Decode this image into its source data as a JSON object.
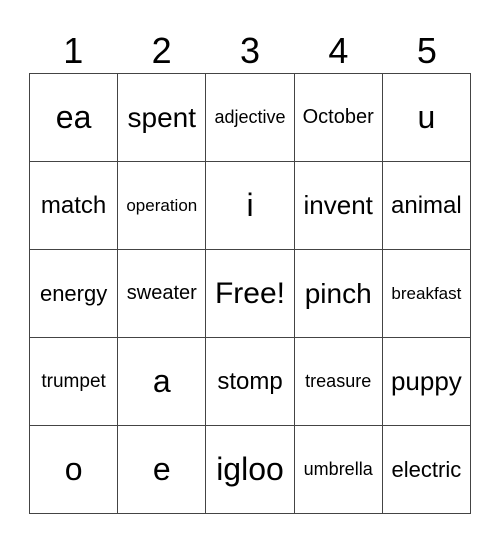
{
  "header": [
    "1",
    "2",
    "3",
    "4",
    "5"
  ],
  "cells": [
    [
      "ea",
      "spent",
      "adjective",
      "October",
      "u"
    ],
    [
      "match",
      "operation",
      "i",
      "invent",
      "animal"
    ],
    [
      "energy",
      "sweater",
      "Free!",
      "pinch",
      "breakfast"
    ],
    [
      "trumpet",
      "a",
      "stomp",
      "treasure",
      "puppy"
    ],
    [
      "o",
      "e",
      "igloo",
      "umbrella",
      "electric"
    ]
  ]
}
